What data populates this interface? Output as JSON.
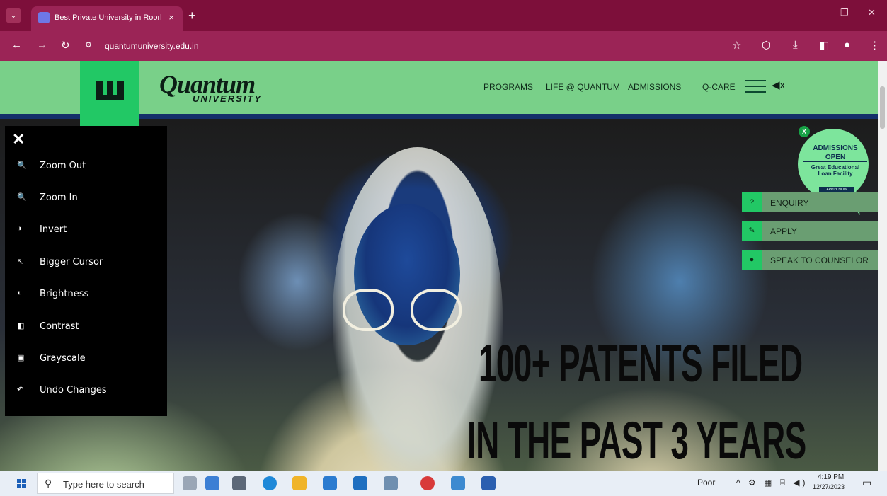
{
  "browser": {
    "tab_title": "Best Private University in Roork",
    "tab_close": "×",
    "new_tab": "+",
    "url": "quantumuniversity.edu.in"
  },
  "site": {
    "brand_name": "Quantum",
    "brand_sub": "UNIVERSITY",
    "nav": [
      "PROGRAMS",
      "LIFE @ QUANTUM",
      "ADMISSIONS",
      "Q-CARE"
    ],
    "mute_label": "◀x"
  },
  "accessibility": {
    "close": "✕",
    "items": [
      {
        "icon": "zoom-out-icon",
        "glyph": "🔍",
        "label": "Zoom Out"
      },
      {
        "icon": "zoom-in-icon",
        "glyph": "🔍",
        "label": "Zoom In"
      },
      {
        "icon": "invert-icon",
        "glyph": "◑",
        "label": "Invert"
      },
      {
        "icon": "cursor-icon",
        "glyph": "↖",
        "label": "Bigger Cursor"
      },
      {
        "icon": "brightness-icon",
        "glyph": "◐",
        "label": "Brightness"
      },
      {
        "icon": "contrast-icon",
        "glyph": "◧",
        "label": "Contrast"
      },
      {
        "icon": "grayscale-icon",
        "glyph": "▣",
        "label": "Grayscale"
      },
      {
        "icon": "undo-icon",
        "glyph": "↶",
        "label": "Undo Changes"
      }
    ]
  },
  "badge": {
    "close": "X",
    "line1": "ADMISSIONS",
    "line2": "OPEN",
    "line3a": "Great Educational",
    "line3b": "Loan Facility",
    "button": "APPLY NOW"
  },
  "side_actions": [
    {
      "icon": "enquiry-icon",
      "glyph": "?",
      "label": "ENQUIRY"
    },
    {
      "icon": "apply-icon",
      "glyph": "✎",
      "label": "APPLY"
    },
    {
      "icon": "counselor-icon",
      "glyph": "●",
      "label": "SPEAK TO COUNSELOR"
    }
  ],
  "hero": {
    "line1": "100+ PATENTS FILED",
    "line2": "IN THE PAST 3 YEARS"
  },
  "taskbar": {
    "search_placeholder": "Type here to search",
    "weather": "Poor",
    "time": "4:19 PM",
    "date": "12/27/2023"
  },
  "colors": {
    "chrome_accent": "#9b2456",
    "site_header": "#79d089",
    "brand_green": "#22c865"
  }
}
